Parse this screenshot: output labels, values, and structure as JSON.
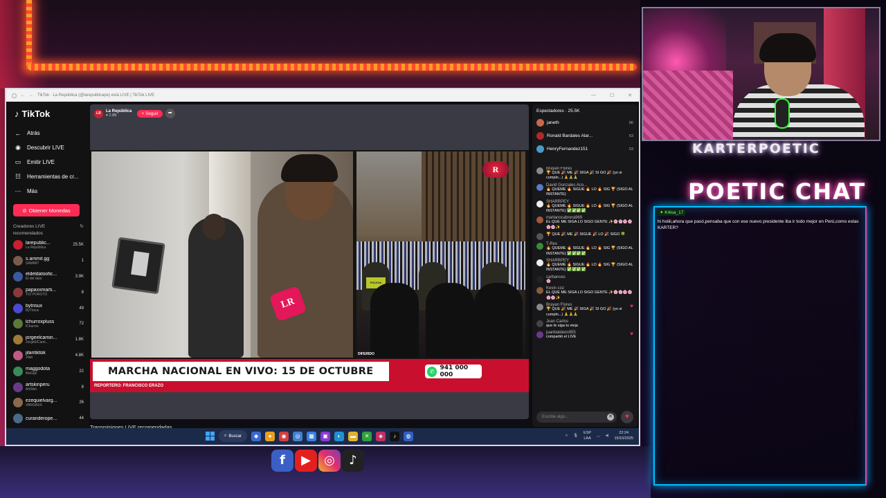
{
  "browser": {
    "tab_title": "TikTok · La República (@larepublicape) está LIVE | TikTok LIVE"
  },
  "sidebar": {
    "logo": "TikTok",
    "nav": [
      {
        "label": "Atrás",
        "icon": "arrow-left-icon"
      },
      {
        "label": "Descubrir LIVE",
        "icon": "live-icon"
      },
      {
        "label": "Emitir LIVE",
        "icon": "camera-icon"
      },
      {
        "label": "Herramientas de cr...",
        "icon": "tools-icon"
      },
      {
        "label": "Más",
        "icon": "more-icon"
      }
    ],
    "coins_button": "Obtener Monedas",
    "creators_header": "Creadores LIVE recomendados",
    "creators": [
      {
        "name": "larepublic...",
        "sub": "La República",
        "count": "25.5K",
        "color": "#c8202f"
      },
      {
        "name": "s.ammit.gg",
        "sub": "SAMMIT",
        "count": "1",
        "color": "#7a5a4a"
      },
      {
        "name": "eldeldatoofic...",
        "sub": "El del dato",
        "count": "3.9K",
        "color": "#3a5aa0"
      },
      {
        "name": "papaxxmarti...",
        "sub": "TIO POROTO",
        "count": "8",
        "color": "#8a3a3a"
      },
      {
        "name": "bytrisux",
        "sub": "ByTrisux",
        "count": "49",
        "color": "#4a4ad0"
      },
      {
        "name": "lchurroxpluss",
        "sub": "lChurrox",
        "count": "72",
        "color": "#5a7a3a"
      },
      {
        "name": "jorgeelcamin...",
        "sub": "JorgeElCami...",
        "count": "1.8K",
        "color": "#a07a3a"
      },
      {
        "name": "jilaritiktok",
        "sub": "Jilari",
        "count": "4.8K",
        "color": "#c05a8a"
      },
      {
        "name": "maggodota",
        "sub": "MaGgo",
        "count": "22",
        "color": "#3a8a5a"
      },
      {
        "name": "artskinperu",
        "sub": "ArtSkin",
        "count": "8",
        "color": "#6a3a8a"
      },
      {
        "name": "ezequielvarg...",
        "sub": "VARGASS",
        "count": "26",
        "color": "#8a6a4a"
      },
      {
        "name": "curanderope...",
        "sub": "",
        "count": "44",
        "color": "#4a6a8a"
      }
    ]
  },
  "live": {
    "host_name": "La República",
    "host_initials": "LR",
    "host_followers": "2.3M",
    "follow_label": "+ Seguir",
    "headline": "MARCHA NACIONAL EN VIVO: 15 DE OCTUBRE",
    "phone": "941 000 000",
    "reporter": "REPORTERO: FRANCISCO ERAZO",
    "channel_logo": "R",
    "mic_logo": "LR",
    "vest_text": "POLICIA",
    "diferido": "DIFERIDO",
    "recommended_title": "Transmisiones LIVE recomendadas"
  },
  "chat": {
    "viewers_label": "Espectadores · 25.5K",
    "top_viewers": [
      {
        "name": "janeth",
        "count": "86",
        "color": "#c86a4a"
      },
      {
        "name": "Ronald Bardales Alar...",
        "count": "63",
        "color": "#b02a2a"
      },
      {
        "name": "HenryFernandez151",
        "count": "53",
        "color": "#4a9ac8"
      }
    ],
    "messages": [
      {
        "user": "Brayan Flores",
        "text": "🏆 QUE 🎉 ME 🎉 SIGA 🎉 SI GO 🎉 (yo si cumplo...) 🙏🙏🙏",
        "color": "#888",
        "heart": false
      },
      {
        "user": "David Gonzales Aco...",
        "text": "🔥 QUEME 🔥 SIGUE 🔥 LO 🔥 SIG 🏆 (SIGO AL INSTANTE)",
        "color": "#5a7ac8",
        "heart": false
      },
      {
        "user": "SHARRPEY",
        "text": "🔥 QUEME 🔥 SIGUE 🔥 LO 🔥 SIG 🏆 (SIGO AL INSTANTE) ✅✅✅✅",
        "color": "#eee",
        "heart": false
      },
      {
        "user": "marlanocabrera969",
        "text": "EL QUE ME SIGA LO SIGO GENTE ✨🌸🌸🌸🌸🌸🌸✨",
        "color": "#a05a3a",
        "heart": false
      },
      {
        "user": "",
        "text": "🏆 QUE 🎉 ME 🎉 SIGUE 🎉 LO 🎉 SIGO 🍀",
        "color": "#555",
        "heart": false
      },
      {
        "user": "T-Rex",
        "text": "🔥 QUEME 🔥 SIGUE 🔥 LO 🔥 SIG 🏆 (SIGO AL INSTANTE) ✅✅✅✅",
        "color": "#3a8a3a",
        "heart": false
      },
      {
        "user": "SHARRPEY",
        "text": "🔥 QUEME 🔥 SIGUE 🔥 LO 🔥 SIG 🏆 (SIGO AL INSTANTE) ✅✅✅✅",
        "color": "#eee",
        "heart": false
      },
      {
        "user": "carbances",
        "text": "🌸",
        "color": "#222",
        "heart": false
      },
      {
        "user": "Kevin coz",
        "text": "EL QUE ME SIGA LO SIGO GENTE ✨🌸🌸🌸🌸🌸🌸✨",
        "color": "#8a5a3a",
        "heart": false
      },
      {
        "user": "Brayan Flores",
        "text": "🏆 QUE 🎉 ME 🎉 SIGA 🎉 SI GO 🎉 (yo si cumplo...) 🙏🙏🙏",
        "color": "#888",
        "heart": true
      },
      {
        "user": "Juan Carlos",
        "text": "que te siga tu vieja",
        "color": "#444",
        "heart": false
      },
      {
        "user": "juanbaldeon955",
        "text": "compartió el LIVE",
        "color": "#6a3a8a",
        "heart": true
      }
    ],
    "input_placeholder": "Escribe algo..."
  },
  "taskbar": {
    "search_label": "Buscar",
    "lang_line1": "ESP",
    "lang_line2": "LAA",
    "time": "22:24",
    "date": "15/10/2025",
    "apps": [
      "chrome",
      "edge",
      "files",
      "store",
      "tiktok",
      "xbox",
      "spotify",
      "discord",
      "obs",
      "vscode",
      "app",
      "app"
    ]
  },
  "stream_overlay": {
    "brand": "KARTERPOETIC",
    "chat_title": "POETIC CHAT",
    "message_user": "K4isa_17",
    "message_text": "hi holiii,ahora que pasó,pensaba que con ese nuevo presidente iba ir todo mejor en Perú,como estas KARTER?"
  }
}
